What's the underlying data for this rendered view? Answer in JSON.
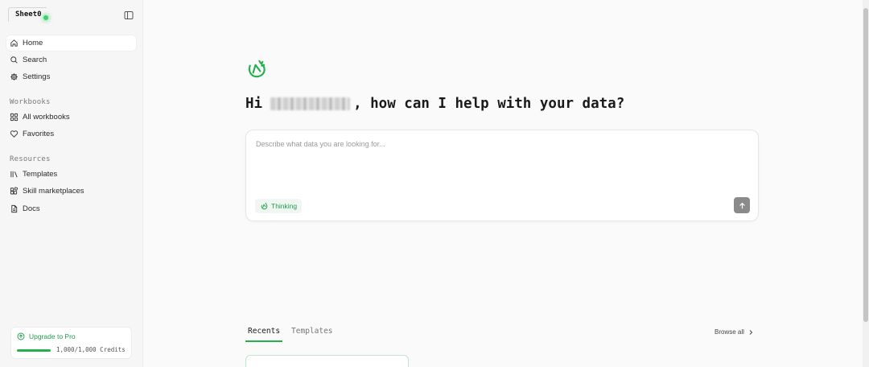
{
  "app": {
    "logo_text": "Sheet0"
  },
  "sidebar": {
    "primary_items": [
      {
        "label": "Home",
        "icon": "home-icon",
        "active": true
      },
      {
        "label": "Search",
        "icon": "search-icon",
        "active": false
      },
      {
        "label": "Settings",
        "icon": "gear-icon",
        "active": false
      }
    ],
    "workbooks": {
      "title": "Workbooks",
      "items": [
        {
          "label": "All workbooks",
          "icon": "grid-icon"
        },
        {
          "label": "Favorites",
          "icon": "heart-icon"
        }
      ]
    },
    "resources": {
      "title": "Resources",
      "items": [
        {
          "label": "Templates",
          "icon": "library-icon"
        },
        {
          "label": "Skill marketplaces",
          "icon": "blocks-icon"
        },
        {
          "label": "Docs",
          "icon": "document-icon"
        }
      ]
    },
    "upgrade": {
      "label": "Upgrade to Pro",
      "credits_text": "1,000/1,000 Credits",
      "credits_fraction": 1.0
    }
  },
  "main": {
    "greeting": {
      "prefix": "Hi",
      "suffix": ", how can I help with your data?"
    },
    "prompt": {
      "placeholder": "Describe what data you are looking for...",
      "thinking_label": "Thinking"
    },
    "tabs": [
      {
        "label": "Recents",
        "active": true
      },
      {
        "label": "Templates",
        "active": false
      }
    ],
    "browse_all_label": "Browse all"
  },
  "colors": {
    "accent_green": "#22b14c",
    "sidebar_bg": "#f6f6f6",
    "send_button": "#8a8a8a"
  }
}
